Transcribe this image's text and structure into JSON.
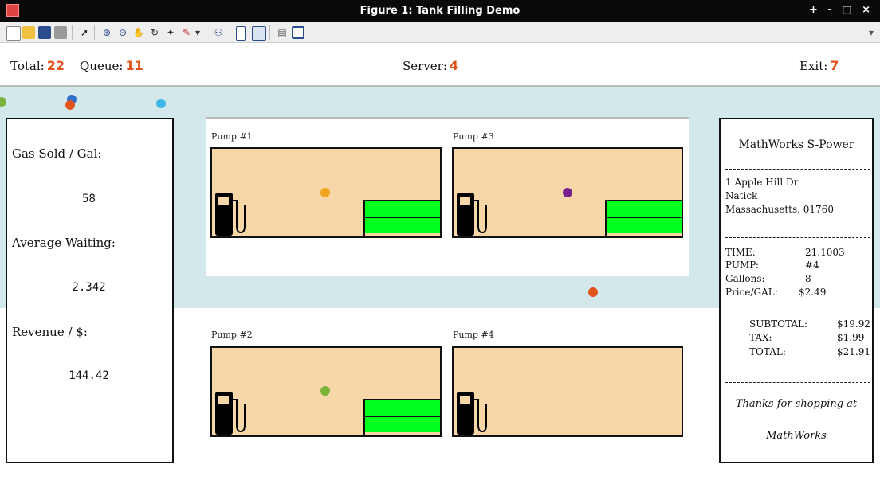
{
  "window": {
    "title": "Figure 1: Tank Filling Demo",
    "controls": "+ - □ ×"
  },
  "toolbar": {
    "icons": [
      "new-file-icon",
      "open-folder-icon",
      "save-icon",
      "print-icon",
      "pointer-icon",
      "zoom-in-icon",
      "zoom-out-icon",
      "pan-icon",
      "rotate-3d-icon",
      "data-cursor-icon",
      "brush-icon",
      "link-plot-icon",
      "colorbar-icon",
      "legend-icon",
      "hide-tools-icon",
      "dock-icon"
    ]
  },
  "header": {
    "total_label": "Total:",
    "total_value": "22",
    "queue_label": "Queue:",
    "queue_value": "11",
    "server_label": "Server:",
    "server_value": "4",
    "exit_label": "Exit:",
    "exit_value": "7"
  },
  "stats": {
    "gas_sold_label": "Gas Sold / Gal:",
    "gas_sold_value": "58",
    "avg_wait_label": "Average Waiting:",
    "avg_wait_value": "2.342",
    "revenue_label": "Revenue / $:",
    "revenue_value": "144.42"
  },
  "pumps": [
    {
      "label": "Pump #1",
      "tank_level": 2
    },
    {
      "label": "Pump #3",
      "tank_level": 2
    },
    {
      "label": "Pump #2",
      "tank_level": 2
    },
    {
      "label": "Pump #4",
      "tank_level": 0
    }
  ],
  "receipt": {
    "company": "MathWorks S-Power",
    "address1": "1 Apple Hill Dr",
    "address2": "Natick",
    "address3": "Massachusetts, 01760",
    "time_label": "TIME:",
    "time_value": "21.1003",
    "pump_label": "PUMP:",
    "pump_value": "#4",
    "gallons_label": "Gallons:",
    "gallons_value": "8",
    "price_label": "Price/GAL:",
    "price_value": "$2.49",
    "subtotal_label": "SUBTOTAL:",
    "subtotal_value": "$19.92",
    "tax_label": "TAX:",
    "tax_value": "$1.99",
    "total_label": "TOTAL:",
    "total_value": "$21.91",
    "thanks1": "Thanks for shopping at",
    "thanks2": "MathWorks"
  },
  "colors": {
    "accent": "#e0541c",
    "road": "#d2e8eb",
    "pump_bg": "#f7d7a7",
    "tank": "#00ff1c",
    "car_orange": "#f0a520",
    "car_purple": "#7a1f8f",
    "car_green": "#7ab33a",
    "car_red": "#e0541c",
    "car_blue": "#2f6fc9",
    "car_lightblue": "#3fb6ea"
  }
}
